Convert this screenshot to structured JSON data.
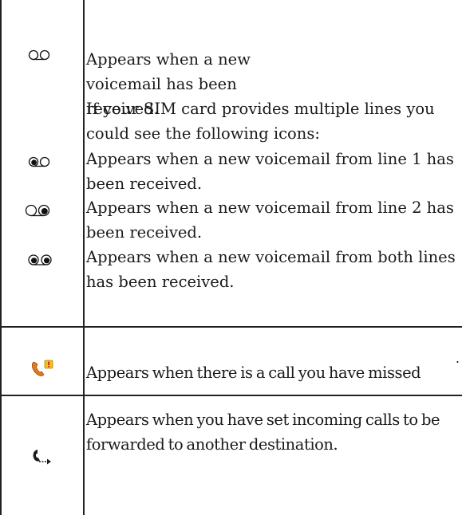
{
  "voicemail": {
    "new_voicemail": "Appears when a new voicemail has been received.",
    "multiline_note": "If your SIM card provides multiple lines you could see the following icons:",
    "line1_voicemail": "Appears when a new voicemail from line 1 has been received.",
    "line2_voicemail": "Appears when a new voicemail from line 2 has been received.",
    "both_lines_voicemail": "Appears when a new voicemail from both lines has been received."
  },
  "missed_call": {
    "dot": ".",
    "text": "Appears when there is a call you have missed"
  },
  "forwarding": {
    "text": "Appears when you have set incoming calls to be forwarded to another destination."
  },
  "icons": {
    "voicemail": "voicemail-icon",
    "voicemail_line1": "voicemail-line1-icon",
    "voicemail_line2": "voicemail-line2-icon",
    "voicemail_both": "voicemail-both-lines-icon",
    "missed_call": "missed-call-icon",
    "call_forward": "call-forward-icon"
  },
  "colors": {
    "missed_call_handset": "#e07a1c",
    "missed_call_badge": "#f2c21b",
    "missed_call_badge_mark": "#c0261c",
    "table_lines": "#222222"
  }
}
